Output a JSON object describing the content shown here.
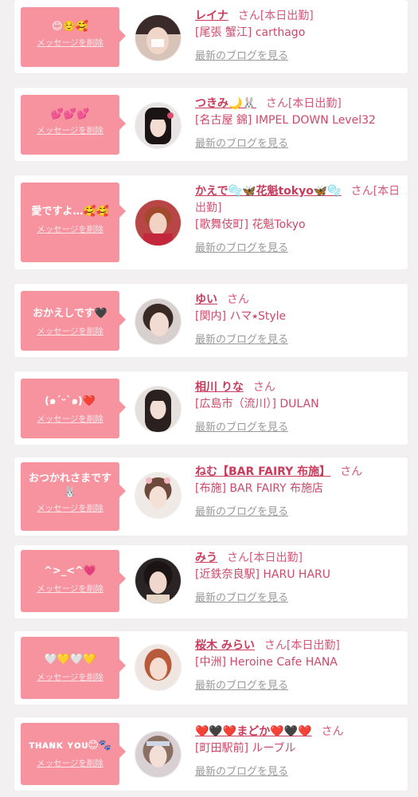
{
  "delete_label": "メッセージを削除",
  "blog_label": "最新のブログを見る",
  "san_label": "さん",
  "colors": {
    "accent_pink": "#f6939f",
    "name_pink": "#c93c5c",
    "link_gray": "#9a9a9a"
  },
  "messages": [
    {
      "message": "😊☺️🥰",
      "name": "レイナ",
      "badge": "[本日出勤]",
      "area": "[尾張 蟹江]",
      "shop": "carthago",
      "avatar_icon": "avatar-photo-icon"
    },
    {
      "message": "💕💕💕",
      "name": "つきみ🌙🐰",
      "badge": "[本日出勤]",
      "area": "[名古屋 錦]",
      "shop": "IMPEL DOWN Level32",
      "avatar_icon": "avatar-photo-icon"
    },
    {
      "message": "愛ですよ…🥰🥰",
      "name": "かえで🫧🦋花魁tokyo🦋🫧",
      "badge": "[本日出勤]",
      "area": "[歌舞伎町]",
      "shop": "花魁Tokyo",
      "avatar_icon": "avatar-photo-icon"
    },
    {
      "message": "おかえしです🖤",
      "name": "ゆい",
      "badge": "",
      "area": "[関内]",
      "shop": "ハマ⭑Style",
      "avatar_icon": "avatar-photo-icon"
    },
    {
      "message": "(๑´ᵕ`๑)❤️",
      "name": "相川 りな",
      "badge": "",
      "area": "[広島市（流川）]",
      "shop": "DULAN",
      "avatar_icon": "avatar-photo-icon"
    },
    {
      "message": "おつかれさまです🐰",
      "name": "ねむ【BAR FAIRY 布施】",
      "badge": "",
      "area": "[布施]",
      "shop": "BAR FAIRY 布施店",
      "avatar_icon": "avatar-photo-icon"
    },
    {
      "message": "^>_<^💗",
      "name": "みう",
      "badge": "[本日出勤]",
      "area": "[近鉄奈良駅]",
      "shop": "HARU HARU",
      "avatar_icon": "avatar-photo-icon"
    },
    {
      "message": "🤍💛🤍💛",
      "name": "桜木 みらい",
      "badge": "[本日出勤]",
      "area": "[中洲]",
      "shop": "Heroine Cafe HANA",
      "avatar_icon": "avatar-photo-icon"
    },
    {
      "message": "ᴛʜᴀɴᴋ ʏᴏᴜ😊🐾",
      "name": "❤️🖤❤️まどか❤️🖤❤️",
      "badge": "",
      "area": "[町田駅前]",
      "shop": "ルーブル",
      "avatar_icon": "avatar-photo-icon"
    }
  ]
}
